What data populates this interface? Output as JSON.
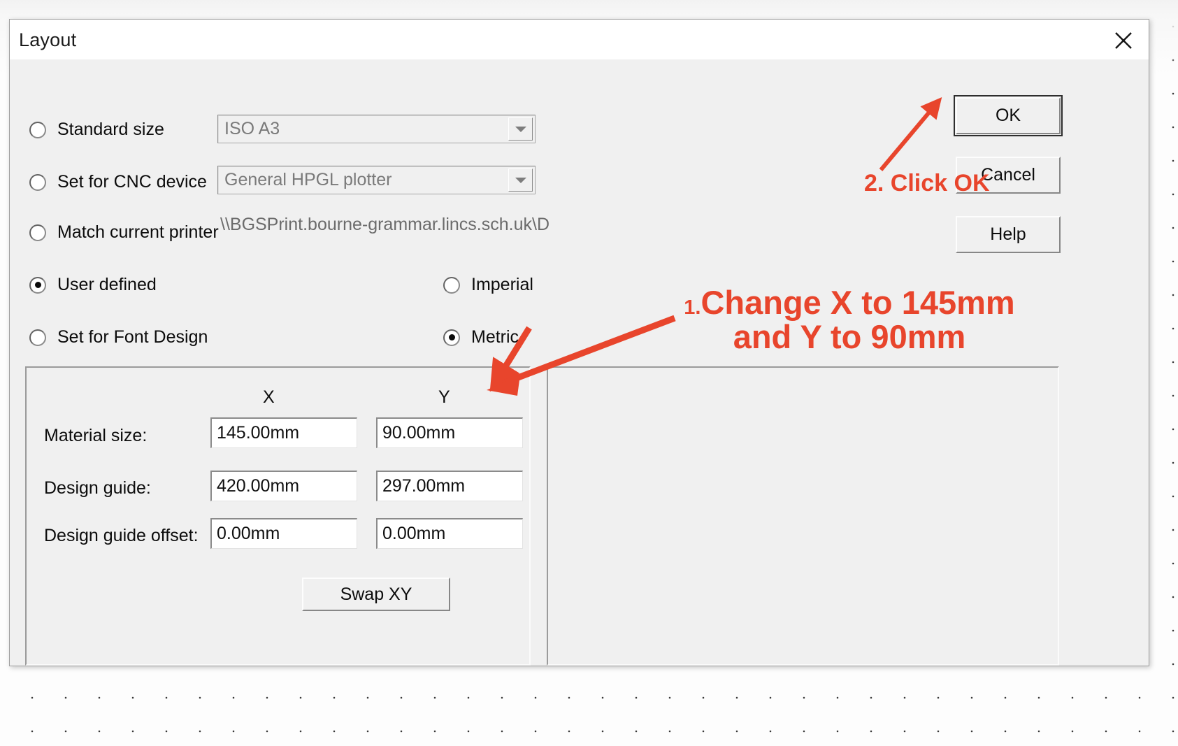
{
  "window": {
    "title": "Layout",
    "close_icon": "close-icon"
  },
  "options": {
    "standard_size": {
      "label": "Standard size",
      "checked": false,
      "value": "ISO A3"
    },
    "cnc_device": {
      "label": "Set for CNC device",
      "checked": false,
      "value": "General HPGL plotter"
    },
    "match_printer": {
      "label": "Match current printer",
      "checked": false,
      "value": "\\\\BGSPrint.bourne-grammar.lincs.sch.uk\\D"
    },
    "user_defined": {
      "label": "User defined",
      "checked": true
    },
    "font_design": {
      "label": "Set for Font Design",
      "checked": false
    },
    "imperial": {
      "label": "Imperial",
      "checked": false
    },
    "metric": {
      "label": "Metric",
      "checked": true
    }
  },
  "size_group": {
    "col_x": "X",
    "col_y": "Y",
    "rows": [
      {
        "label": "Material size:",
        "x": "145.00mm",
        "y": "90.00mm"
      },
      {
        "label": "Design guide:",
        "x": "420.00mm",
        "y": "297.00mm"
      },
      {
        "label": "Design guide offset:",
        "x": "0.00mm",
        "y": "0.00mm"
      }
    ],
    "swap_button": "Swap XY"
  },
  "buttons": {
    "ok": "OK",
    "cancel": "Cancel",
    "help": "Help"
  },
  "annotations": {
    "step1_num": "1.",
    "step1_line1": "Change X to 145mm",
    "step1_line2": "and Y to 90mm",
    "step2": "2. Click OK",
    "color": "#E8452C"
  }
}
